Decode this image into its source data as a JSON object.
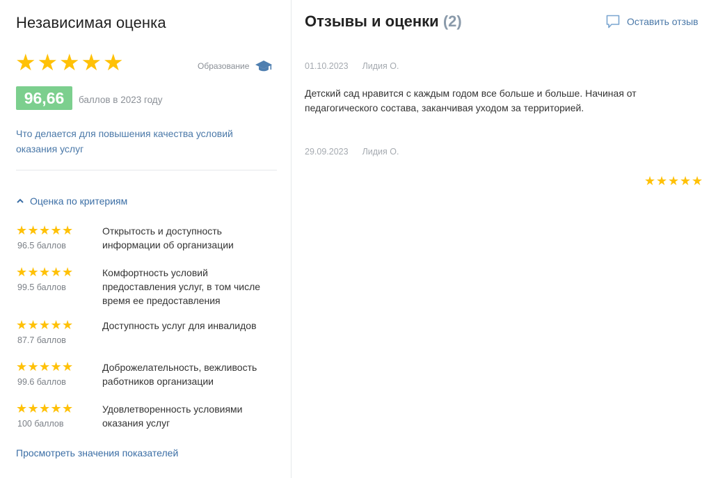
{
  "left": {
    "title": "Независимая оценка",
    "rating_stars": 5,
    "category_label": "Образование",
    "category_icon": "graduation-cap-icon",
    "score": "96,66",
    "score_caption": "баллов в 2023 году",
    "quality_link": "Что делается для повышения качества условий оказания услуг",
    "criteria_toggle": "Оценка по критериям",
    "criteria": [
      {
        "stars": 5,
        "score": "96.5 баллов",
        "label": "Открытость и доступность информации об организации"
      },
      {
        "stars": 5,
        "score": "99.5 баллов",
        "label": "Комфортность условий предоставления услуг, в том числе время ее предоставления"
      },
      {
        "stars": 5,
        "score": "87.7 баллов",
        "label": "Доступность услуг для инвалидов"
      },
      {
        "stars": 5,
        "score": "99.6 баллов",
        "label": "Доброжелательность, вежливость работников организации"
      },
      {
        "stars": 5,
        "score": "100 баллов",
        "label": "Удовлетворенность условиями оказания услуг"
      }
    ],
    "view_link": "Просмотреть значения показателей"
  },
  "right": {
    "title": "Отзывы и оценки",
    "count": "(2)",
    "leave_review": "Оставить отзыв",
    "reviews": [
      {
        "date": "01.10.2023",
        "author": "Лидия О.",
        "text": "Детский сад нравится с каждым годом все больше и больше. Начиная от педагогического состава, заканчивая уходом за территорией."
      },
      {
        "date": "29.09.2023",
        "author": "Лидия О.",
        "stars": 5
      }
    ]
  },
  "colors": {
    "star": "#ffc107",
    "badge": "#7ccf8e",
    "link": "#3b6ea5",
    "muted": "#8a8f96"
  }
}
